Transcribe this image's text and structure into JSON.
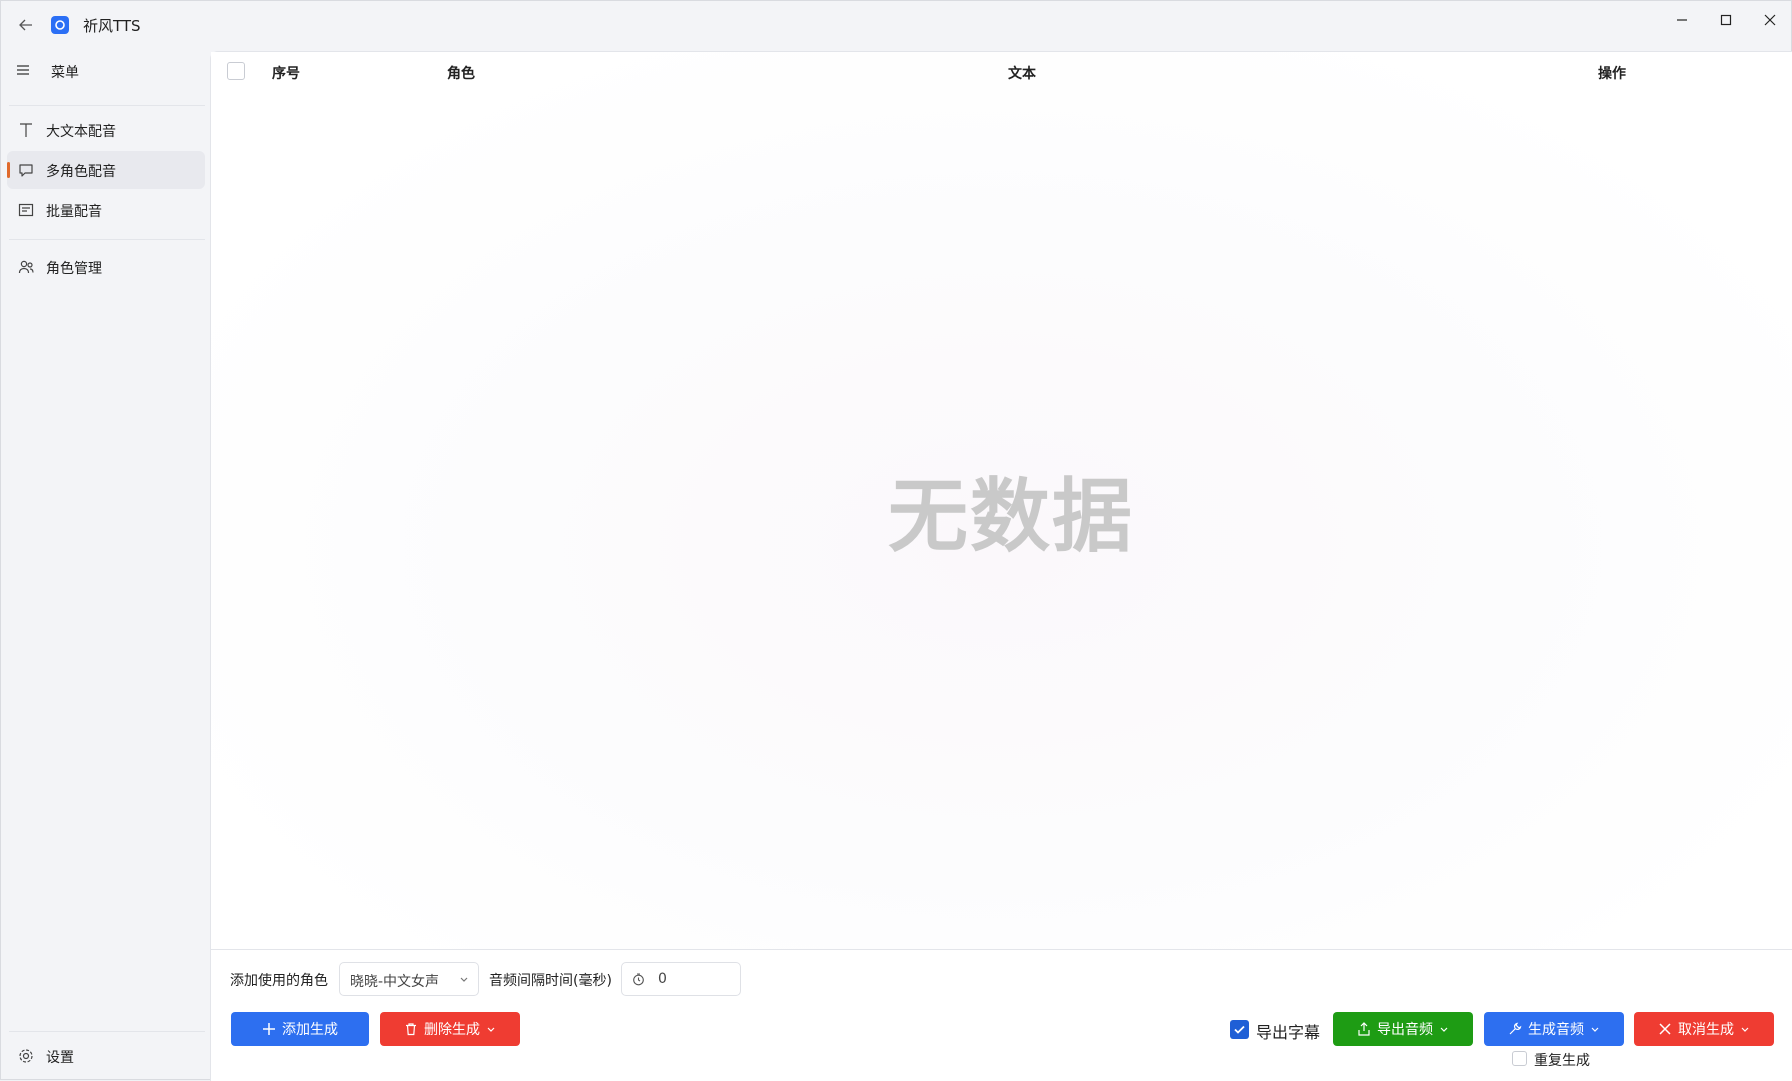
{
  "app": {
    "title": "祈风TTS",
    "colors": {
      "accent": "#2d6ff0",
      "danger": "#ef3c32",
      "success": "#1e9c14",
      "nav_indicator": "#e06a2c"
    }
  },
  "window_controls": {
    "minimize_icon": "minimize-icon",
    "maximize_icon": "maximize-icon",
    "close_icon": "close-icon"
  },
  "sidebar": {
    "menu_label": "菜单",
    "items": [
      {
        "label": "大文本配音",
        "icon": "text-icon",
        "active": false
      },
      {
        "label": "多角色配音",
        "icon": "chat-icon",
        "active": true
      },
      {
        "label": "批量配音",
        "icon": "list-icon",
        "active": false
      },
      {
        "label": "角色管理",
        "icon": "users-icon",
        "active": false
      }
    ],
    "settings_label": "设置"
  },
  "table": {
    "columns": [
      "序号",
      "角色",
      "文本",
      "操作"
    ],
    "rows": [],
    "empty_text": "无数据"
  },
  "controls": {
    "role_label": "添加使用的角色",
    "role_value": "晓晓-中文女声",
    "interval_label": "音频间隔时间(毫秒)",
    "interval_value": "0",
    "add_label": "添加生成",
    "delete_label": "删除生成",
    "export_subtitle_label": "导出字幕",
    "export_subtitle_checked": true,
    "export_audio_label": "导出音频",
    "generate_audio_label": "生成音频",
    "cancel_label": "取消生成",
    "regenerate_label": "重复生成",
    "regenerate_checked": false
  }
}
